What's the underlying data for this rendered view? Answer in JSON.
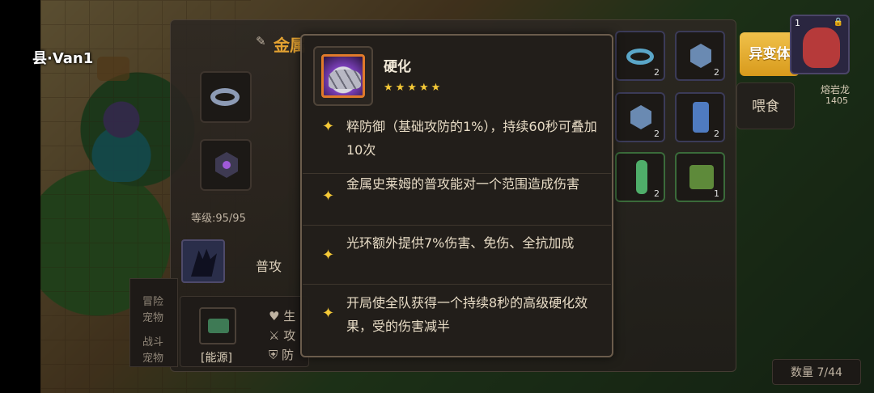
{
  "scene": {
    "player_name": "Van1",
    "player_prefix": "县·"
  },
  "panel": {
    "title_partial": "金属",
    "level_text": "等级:95/95",
    "attack_label": "普攻",
    "energy_label": "[能源]",
    "stats": [
      "生",
      "攻",
      "防"
    ],
    "side_labels": [
      "冒险",
      "宠物",
      "战斗",
      "宠物"
    ]
  },
  "inventory": {
    "slots": [
      {
        "icon": "ring-icon",
        "qty": "2"
      },
      {
        "icon": "gem-icon",
        "qty": "2"
      },
      {
        "icon": "gem-icon",
        "qty": "2"
      },
      {
        "icon": "can-icon",
        "qty": "2"
      },
      {
        "icon": "vial-icon",
        "qty": "2"
      },
      {
        "icon": "box-icon",
        "qty": "1"
      }
    ],
    "mutate_label": "异变体",
    "feed_label": "喂食",
    "pet_card": {
      "number": "1",
      "name": "熔岩龙",
      "score": "1405"
    },
    "count_text": "数量 7/44"
  },
  "tooltip": {
    "skill_name": "硬化",
    "stars": "★★★★★",
    "descriptions": [
      "粹防御（基础攻防的1%），持续60秒可叠加10次",
      "金属史莱姆的普攻能对一个范围造成伤害",
      "光环额外提供7%伤害、免伤、全抗加成",
      "开局使全队获得一个持续8秒的高级硬化效果，受的伤害减半"
    ]
  },
  "colors": {
    "accent_gold": "#f5c937",
    "mutate_button": "#e5ad31",
    "tooltip_border": "#6b5c4c"
  }
}
